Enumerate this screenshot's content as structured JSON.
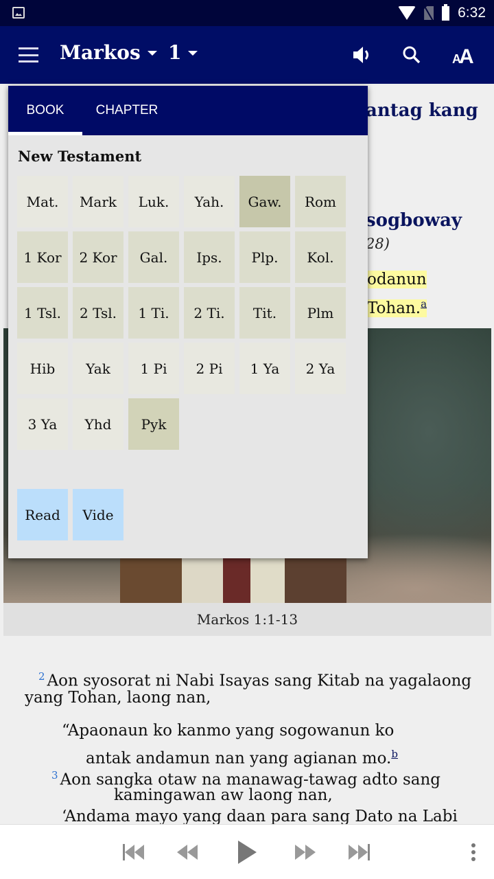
{
  "status_bar": {
    "time": "6:32",
    "icons": [
      "gallery-icon",
      "wifi-icon",
      "no-sim-icon",
      "battery-icon"
    ]
  },
  "app_bar": {
    "menu_icon": "hamburger-icon",
    "book": "Markos",
    "chapter": "1",
    "actions": [
      "speaker-icon",
      "search-icon",
      "text-size-icon"
    ],
    "text_size_label": "AA"
  },
  "content": {
    "heading1_visible": "antag kang",
    "heading2_visible": "sogboway",
    "heading2_ref_visible": "28)",
    "verse1_line1": "odanun",
    "verse1_line2": "Tohan.",
    "verse1_footnote": "a",
    "highlight_color": "#fdfaa0",
    "image_caption": "Markos 1:1-13",
    "passage": {
      "v2_num": "2",
      "v2_line1": "Aon syosorat ni Nabi Isayas sang Kitab na yagalaong",
      "v2_line2": "yang Tohan, laong nan,",
      "q1_line1": "“Apaonaun ko kanmo yang sogowanun ko",
      "q1_line2": "antak andamun nan yang agianan mo.",
      "q1_footnote": "b",
      "v3_num": "3",
      "v3_line1": "Aon sangka otaw na manawag-tawag adto sang",
      "v3_line2": "kamingawan aw laong nan,",
      "v3_line3": "‘Andama mayo yang daan para sang Dato na Labi"
    }
  },
  "book_picker": {
    "tabs": [
      {
        "label": "BOOK",
        "active": true
      },
      {
        "label": "CHAPTER",
        "active": false
      }
    ],
    "section_title": "New Testament",
    "books": [
      {
        "label": "Mat.",
        "state": "light"
      },
      {
        "label": "Mark",
        "state": "light"
      },
      {
        "label": "Luk.",
        "state": "light"
      },
      {
        "label": "Yah.",
        "state": "light"
      },
      {
        "label": "Gaw.",
        "state": "selected"
      },
      {
        "label": "Rom",
        "state": "normal"
      },
      {
        "label": "1 Kor",
        "state": "normal"
      },
      {
        "label": "2 Kor",
        "state": "normal"
      },
      {
        "label": "Gal.",
        "state": "normal"
      },
      {
        "label": "Ips.",
        "state": "normal"
      },
      {
        "label": "Plp.",
        "state": "normal"
      },
      {
        "label": "Kol.",
        "state": "normal"
      },
      {
        "label": "1 Tsl.",
        "state": "normal"
      },
      {
        "label": "2 Tsl.",
        "state": "normal"
      },
      {
        "label": "1 Ti.",
        "state": "normal"
      },
      {
        "label": "2 Ti.",
        "state": "normal"
      },
      {
        "label": "Tit.",
        "state": "normal"
      },
      {
        "label": "Plm",
        "state": "normal"
      },
      {
        "label": "Hib",
        "state": "light"
      },
      {
        "label": "Yak",
        "state": "light"
      },
      {
        "label": "1 Pi",
        "state": "light"
      },
      {
        "label": "2 Pi",
        "state": "light"
      },
      {
        "label": "1 Ya",
        "state": "light"
      },
      {
        "label": "2 Ya",
        "state": "light"
      },
      {
        "label": "3 Ya",
        "state": "light"
      },
      {
        "label": "Yhd",
        "state": "light"
      },
      {
        "label": "Pyk",
        "state": "sel2"
      }
    ],
    "extras": [
      {
        "label": "Read"
      },
      {
        "label": "Vide"
      }
    ]
  },
  "player": {
    "buttons": [
      "skip-to-start-icon",
      "rewind-icon",
      "play-icon",
      "fast-forward-icon",
      "skip-to-end-icon"
    ],
    "menu_icon": "overflow-menu-icon"
  }
}
